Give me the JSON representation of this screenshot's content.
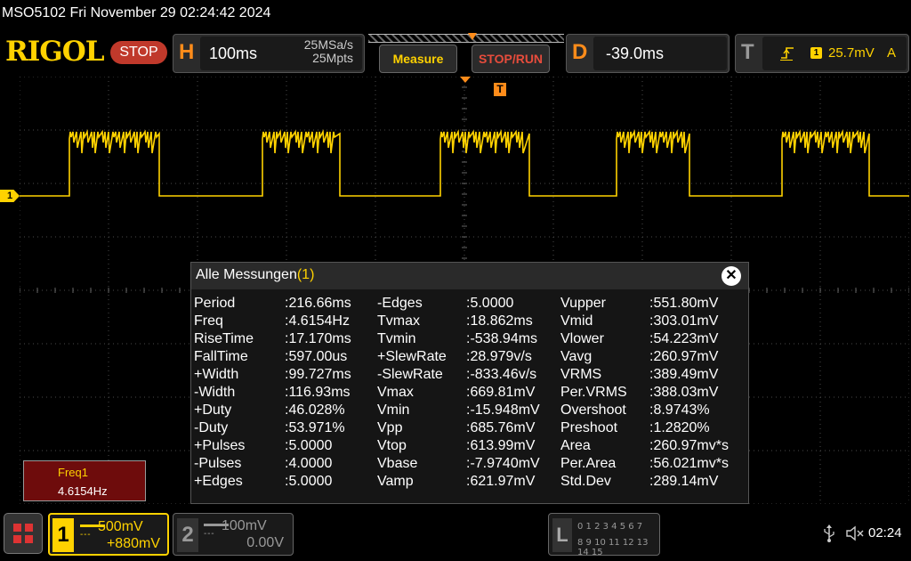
{
  "window": {
    "title": "MSO5102  Fri November 29 02:24:42 2024"
  },
  "toolbar": {
    "logo": "RIGOL",
    "status": "STOP",
    "horizontal": {
      "letter": "H",
      "timebase": "100ms",
      "sample_rate": "25MSa/s",
      "memory_depth": "25Mpts"
    },
    "measure_label": "Measure",
    "stoprun_label": "STOP/RUN",
    "delay": {
      "letter": "D",
      "value": "-39.0ms"
    },
    "trigger": {
      "letter": "T",
      "edge_icon": "rising-edge-icon",
      "source": "1",
      "level": "25.7mV",
      "mode": "A"
    }
  },
  "screen": {
    "trigger_marker": "T",
    "ch1_marker": "1",
    "colors": {
      "ch1": "#ffd200",
      "accent": "#ff8c1a",
      "stop": "#c0392b",
      "grid": "#4a4a4a"
    }
  },
  "measurements": {
    "title": "Alle Messungen",
    "channel": "(1)",
    "close_icon": "close-icon",
    "columns": [
      [
        {
          "name": "Period",
          "value": ":216.66ms"
        },
        {
          "name": "Freq",
          "value": ":4.6154Hz"
        },
        {
          "name": "RiseTime",
          "value": ":17.170ms"
        },
        {
          "name": "FallTime",
          "value": ":597.00us"
        },
        {
          "name": "+Width",
          "value": ":99.727ms"
        },
        {
          "name": "-Width",
          "value": ":116.93ms"
        },
        {
          "name": "+Duty",
          "value": ":46.028%"
        },
        {
          "name": "-Duty",
          "value": ":53.971%"
        },
        {
          "name": "+Pulses",
          "value": ":5.0000"
        },
        {
          "name": "-Pulses",
          "value": ":4.0000"
        },
        {
          "name": "+Edges",
          "value": ":5.0000"
        }
      ],
      [
        {
          "name": "-Edges",
          "value": ":5.0000"
        },
        {
          "name": "Tvmax",
          "value": ":18.862ms"
        },
        {
          "name": "Tvmin",
          "value": ":-538.94ms"
        },
        {
          "name": "+SlewRate",
          "value": ":28.979v/s"
        },
        {
          "name": "-SlewRate",
          "value": ":-833.46v/s"
        },
        {
          "name": "Vmax",
          "value": ":669.81mV"
        },
        {
          "name": "Vmin",
          "value": ":-15.948mV"
        },
        {
          "name": "Vpp",
          "value": ":685.76mV"
        },
        {
          "name": "Vtop",
          "value": ":613.99mV"
        },
        {
          "name": "Vbase",
          "value": ":-7.9740mV"
        },
        {
          "name": "Vamp",
          "value": ":621.97mV"
        }
      ],
      [
        {
          "name": "Vupper",
          "value": ":551.80mV"
        },
        {
          "name": "Vmid",
          "value": ":303.01mV"
        },
        {
          "name": "Vlower",
          "value": ":54.223mV"
        },
        {
          "name": "Vavg",
          "value": ":260.97mV"
        },
        {
          "name": "VRMS",
          "value": ":389.49mV"
        },
        {
          "name": "Per.VRMS",
          "value": ":388.03mV"
        },
        {
          "name": "Overshoot",
          "value": ":8.9743%"
        },
        {
          "name": "Preshoot",
          "value": ":1.2820%"
        },
        {
          "name": "Area",
          "value": ":260.97mv*s"
        },
        {
          "name": "Per.Area",
          "value": ":56.021mv*s"
        },
        {
          "name": "Std.Dev",
          "value": ":289.14mV"
        }
      ]
    ]
  },
  "freq_readout": {
    "label": "Freq1",
    "value": "4.6154Hz"
  },
  "bottombar": {
    "menu_icon": "menu-grid-icon",
    "ch1": {
      "number": "1",
      "coupling": "DC",
      "scale": "500mV",
      "offset": "+880mV"
    },
    "ch2": {
      "number": "2",
      "coupling": "DC",
      "scale": "100mV",
      "offset": "0.00V"
    },
    "la": {
      "letter": "L",
      "row1": "0 1 2 3  4 5 6 7",
      "row2": "8 9 10 11 12 13 14 15"
    },
    "usb_icon": "usb-icon",
    "speaker_icon": "speaker-muted-icon",
    "time": "02:24"
  }
}
